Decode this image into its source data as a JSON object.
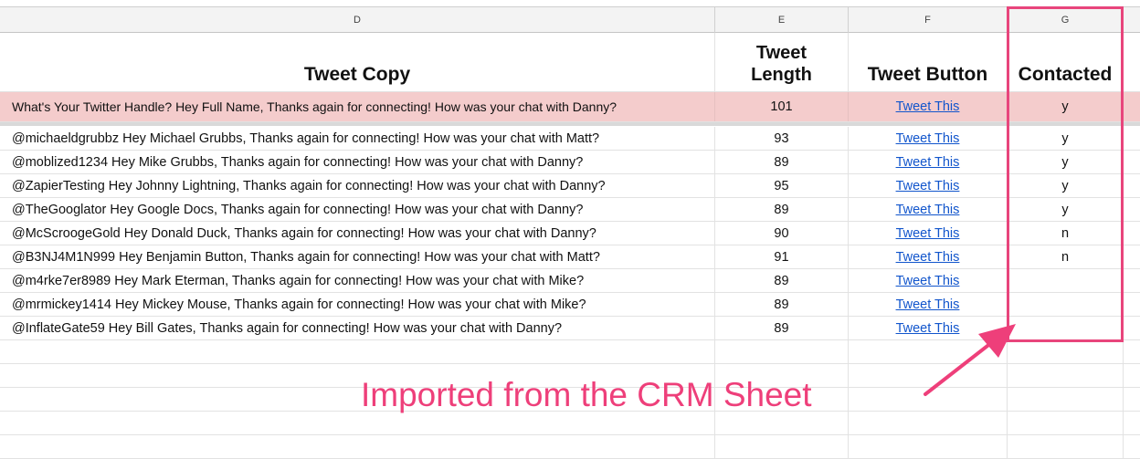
{
  "columns": [
    {
      "letter": "D"
    },
    {
      "letter": "E"
    },
    {
      "letter": "F"
    },
    {
      "letter": "G"
    }
  ],
  "headers": {
    "tweet_copy": "Tweet Copy",
    "tweet_length_1": "Tweet",
    "tweet_length_2": "Length",
    "tweet_button": "Tweet Button",
    "contacted": "Contacted"
  },
  "rows": [
    {
      "copy": "What's Your Twitter Handle? Hey Full Name, Thanks again for connecting! How was your chat with Danny?",
      "length": "101",
      "button": "Tweet This",
      "contacted": "y"
    },
    {
      "copy": "@michaeldgrubbz Hey Michael Grubbs, Thanks again for connecting! How was your chat with Matt?",
      "length": "93",
      "button": "Tweet This",
      "contacted": "y"
    },
    {
      "copy": "@moblized1234 Hey Mike Grubbs, Thanks again for connecting! How was your chat with Danny?",
      "length": "89",
      "button": "Tweet This",
      "contacted": "y"
    },
    {
      "copy": "@ZapierTesting Hey Johnny Lightning, Thanks again for connecting! How was your chat with Danny?",
      "length": "95",
      "button": "Tweet This",
      "contacted": "y"
    },
    {
      "copy": "@TheGooglator Hey Google Docs, Thanks again for connecting! How was your chat with Danny?",
      "length": "89",
      "button": "Tweet This",
      "contacted": "y"
    },
    {
      "copy": "@McScroogeGold Hey Donald Duck, Thanks again for connecting! How was your chat with Danny?",
      "length": "90",
      "button": "Tweet This",
      "contacted": "n"
    },
    {
      "copy": "@B3NJ4M1N999 Hey Benjamin Button, Thanks again for connecting! How was your chat with Matt?",
      "length": "91",
      "button": "Tweet This",
      "contacted": "n"
    },
    {
      "copy": "@m4rke7er8989 Hey Mark Eterman, Thanks again for connecting! How was your chat with Mike?",
      "length": "89",
      "button": "Tweet This",
      "contacted": ""
    },
    {
      "copy": "@mrmickey1414 Hey Mickey Mouse, Thanks again for connecting! How was your chat with Mike?",
      "length": "89",
      "button": "Tweet This",
      "contacted": ""
    },
    {
      "copy": "@InflateGate59 Hey Bill Gates, Thanks again for connecting! How was your chat with Danny?",
      "length": "89",
      "button": "Tweet This",
      "contacted": ""
    }
  ],
  "annotation": "Imported from the CRM Sheet",
  "colors": {
    "highlight": "#e8457c",
    "first_row": "#f4cccc",
    "link": "#1155cc"
  }
}
